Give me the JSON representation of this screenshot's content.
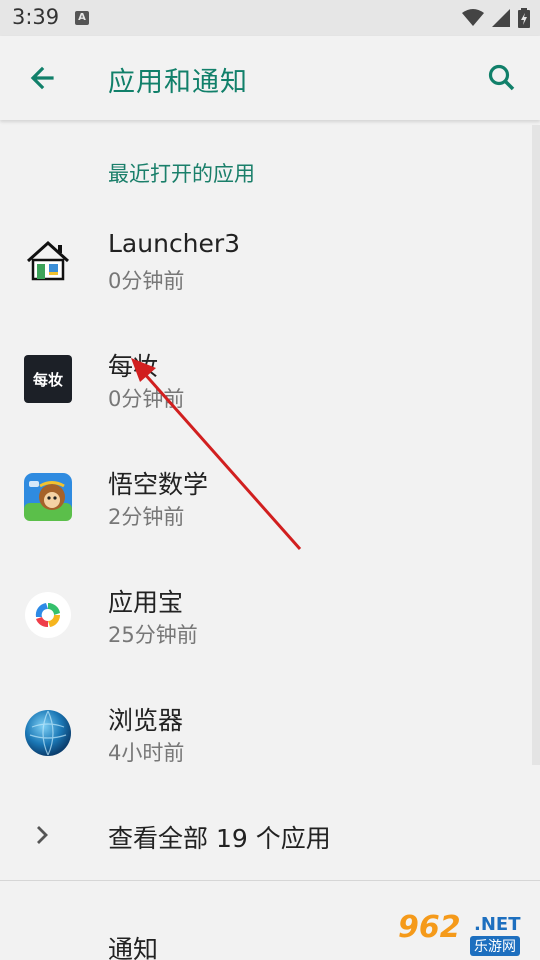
{
  "status": {
    "time": "3:39",
    "notif_icon": "A"
  },
  "appbar": {
    "title": "应用和通知",
    "back_icon": "arrow-back-icon",
    "search_icon": "search-icon"
  },
  "section_title": "最近打开的应用",
  "apps": [
    {
      "name": "Launcher3",
      "time": "0分钟前",
      "icon": "house-icon"
    },
    {
      "name": "每妆",
      "time": "0分钟前",
      "icon": "meizhuang-icon",
      "icon_text": "每妆"
    },
    {
      "name": "悟空数学",
      "time": "2分钟前",
      "icon": "wukong-math-icon"
    },
    {
      "name": "应用宝",
      "time": "25分钟前",
      "icon": "yingyongbao-icon"
    },
    {
      "name": "浏览器",
      "time": "4小时前",
      "icon": "browser-globe-icon"
    }
  ],
  "see_all": {
    "label": "查看全部 19 个应用"
  },
  "notifications": {
    "label": "通知"
  },
  "watermark": {
    "number": "962",
    "suffix": ".NET",
    "cn": "乐游网"
  },
  "colors": {
    "accent": "#11806a",
    "annotation_arrow": "#d11f1f"
  }
}
